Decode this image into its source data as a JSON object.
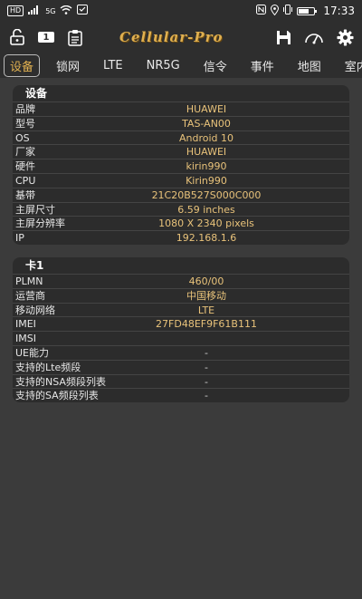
{
  "statusbar": {
    "hd_badge": "HD",
    "net_badge": "5G",
    "time": "17:33",
    "battery_percent": 60
  },
  "toolbar": {
    "app_title": "Cellular-Pro",
    "left_icons": [
      "lock-open-icon",
      "sim-card-icon",
      "clipboard-icon"
    ],
    "right_icons": [
      "save-icon",
      "speedometer-icon",
      "gear-icon"
    ],
    "sim_label": "1"
  },
  "tabs": [
    {
      "label": "设备",
      "active": true
    },
    {
      "label": "锁网",
      "active": false
    },
    {
      "label": "LTE",
      "active": false
    },
    {
      "label": "NR5G",
      "active": false
    },
    {
      "label": "信令",
      "active": false
    },
    {
      "label": "事件",
      "active": false
    },
    {
      "label": "地图",
      "active": false
    },
    {
      "label": "室内",
      "active": false
    }
  ],
  "device": {
    "title": "设备",
    "rows": [
      {
        "key": "品牌",
        "value": "HUAWEI"
      },
      {
        "key": "型号",
        "value": "TAS-AN00"
      },
      {
        "key": "OS",
        "value": "Android 10"
      },
      {
        "key": "厂家",
        "value": "HUAWEI"
      },
      {
        "key": "硬件",
        "value": "kirin990"
      },
      {
        "key": "CPU",
        "value": "Kirin990"
      },
      {
        "key": "基带",
        "value": "21C20B527S000C000"
      },
      {
        "key": "主屏尺寸",
        "value": "6.59 inches"
      },
      {
        "key": "主屏分辨率",
        "value": "1080 X 2340 pixels"
      },
      {
        "key": "IP",
        "value": "192.168.1.6"
      }
    ]
  },
  "sim": {
    "title": "卡1",
    "rows": [
      {
        "key": "PLMN",
        "value": "460/00"
      },
      {
        "key": "运营商",
        "value": "中国移动"
      },
      {
        "key": "移动网络",
        "value": "LTE"
      },
      {
        "key": "IMEI",
        "value": "27FD48EF9F61B111"
      },
      {
        "key": "IMSI",
        "value": ""
      },
      {
        "key": "UE能力",
        "value": "-"
      },
      {
        "key": "支持的Lte频段",
        "value": "-"
      },
      {
        "key": "支持的NSA频段列表",
        "value": "-"
      },
      {
        "key": "支持的SA频段列表",
        "value": "-"
      }
    ]
  }
}
